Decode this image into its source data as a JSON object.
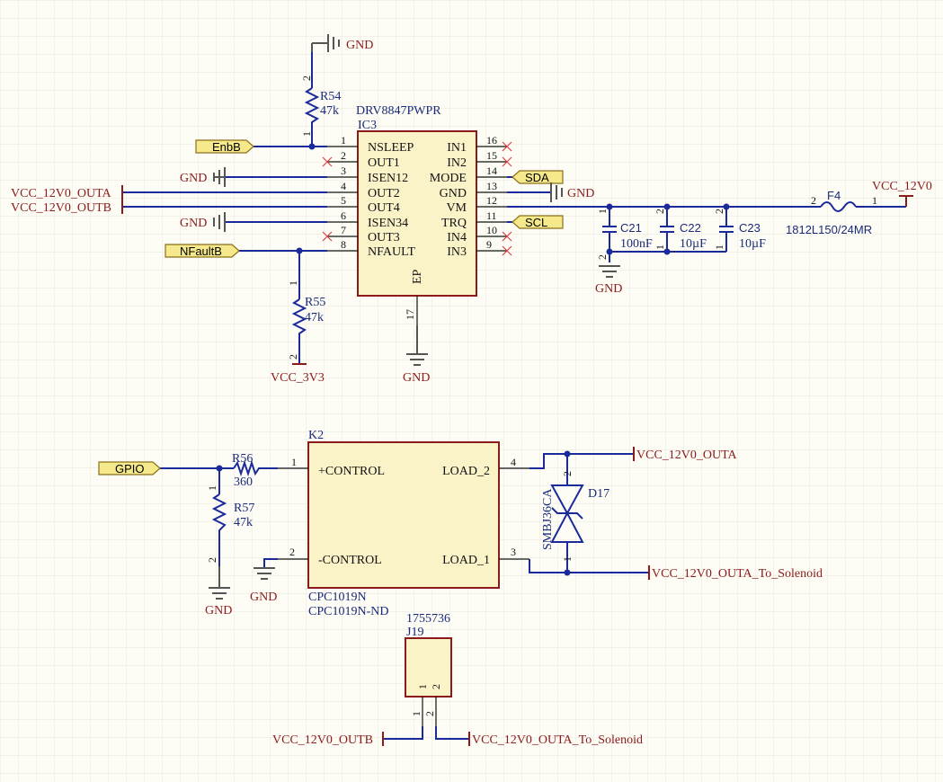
{
  "ic3": {
    "designator": "IC3",
    "part": "DRV8847PWPR",
    "ep_label": "EP",
    "ep_pin": "17",
    "left_pins": [
      {
        "num": "1",
        "name": "NSLEEP"
      },
      {
        "num": "2",
        "name": "OUT1"
      },
      {
        "num": "3",
        "name": "ISEN12"
      },
      {
        "num": "4",
        "name": "OUT2"
      },
      {
        "num": "5",
        "name": "OUT4"
      },
      {
        "num": "6",
        "name": "ISEN34"
      },
      {
        "num": "7",
        "name": "OUT3"
      },
      {
        "num": "8",
        "name": "NFAULT"
      }
    ],
    "right_pins": [
      {
        "num": "16",
        "name": "IN1"
      },
      {
        "num": "15",
        "name": "IN2"
      },
      {
        "num": "14",
        "name": "MODE"
      },
      {
        "num": "13",
        "name": "GND"
      },
      {
        "num": "12",
        "name": "VM"
      },
      {
        "num": "11",
        "name": "TRQ"
      },
      {
        "num": "10",
        "name": "IN4"
      },
      {
        "num": "9",
        "name": "IN3"
      }
    ]
  },
  "r54": {
    "designator": "R54",
    "value": "47k",
    "pin_top": "2",
    "pin_bottom": "1"
  },
  "r55": {
    "designator": "R55",
    "value": "47k",
    "pin_top": "1",
    "pin_bottom": "2"
  },
  "r56": {
    "designator": "R56",
    "value": "360",
    "pin": "1"
  },
  "r57": {
    "designator": "R57",
    "value": "47k",
    "pin_top": "1",
    "pin_bottom": "2"
  },
  "c21": {
    "designator": "C21",
    "value": "100nF",
    "pin_top": "1",
    "pin_bottom": "2"
  },
  "c22": {
    "designator": "C22",
    "value": "10µF",
    "pin_top": "2",
    "pin_bottom": "1"
  },
  "c23": {
    "designator": "C23",
    "value": "10µF",
    "pin_top": "2",
    "pin_bottom": "1"
  },
  "f4": {
    "designator": "F4",
    "part": "1812L150/24MR",
    "pin_left": "2",
    "pin_right": "1"
  },
  "k2": {
    "designator": "K2",
    "part": "CPC1019N",
    "part2": "CPC1019N-ND",
    "pin_ctrl_plus_name": "+CONTROL",
    "pin_ctrl_plus_num": "1",
    "pin_ctrl_minus_name": "-CONTROL",
    "pin_ctrl_minus_num": "2",
    "pin_load2_name": "LOAD_2",
    "pin_load2_num": "4",
    "pin_load1_name": "LOAD_1",
    "pin_load1_num": "3"
  },
  "d17": {
    "designator": "D17",
    "part": "SMBJ36CA",
    "pin_top": "2",
    "pin_bottom": "1"
  },
  "j19": {
    "designator": "J19",
    "part": "1755736",
    "pin1": "1",
    "pin2": "2"
  },
  "nets": {
    "gnd": "GND",
    "enbb": "EnbB",
    "nfaultb": "NFaultB",
    "sda": "SDA",
    "scl": "SCL",
    "gpio": "GPIO",
    "vcc_outa": "VCC_12V0_OUTA",
    "vcc_outb": "VCC_12V0_OUTB",
    "vcc_12v0": "VCC_12V0",
    "vcc_3v3": "VCC_3V3",
    "vcc_outa_sol": "VCC_12V0_OUTA_To_Solenoid"
  },
  "colors": {
    "background": "#fdfdf6",
    "grid": "#e6e6e0",
    "wire": "#1a2a9a",
    "component_body_fill": "#fbf3c8",
    "component_outline": "#8b1a1a",
    "net_label": "#8b1a1a",
    "designator": "#1a2a7a",
    "port_fill": "#f5e98b",
    "no_connect": "#e04040",
    "ground": "#555555"
  }
}
